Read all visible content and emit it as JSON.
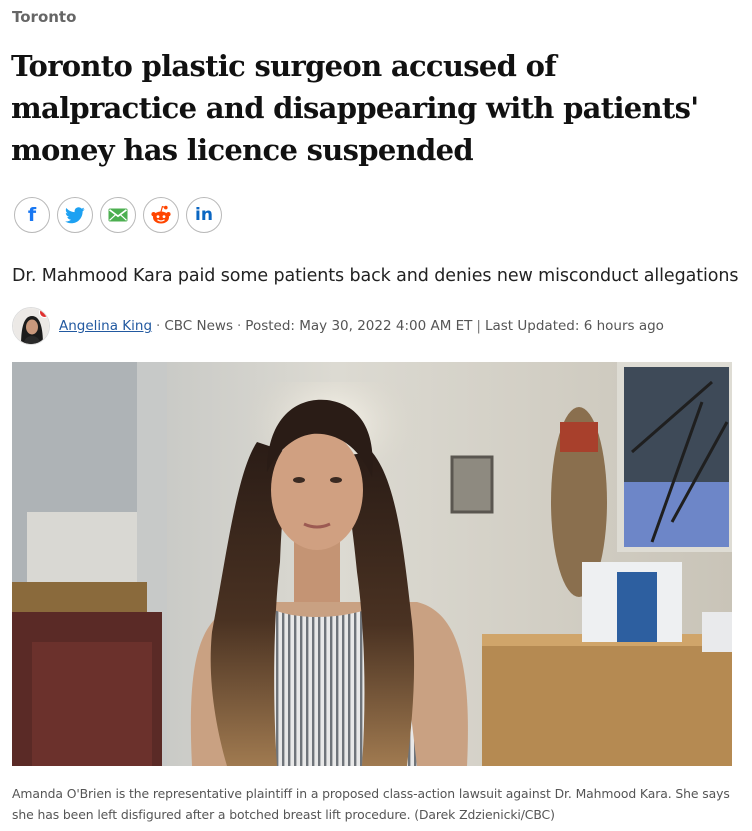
{
  "section": "Toronto",
  "headline": "Toronto plastic surgeon accused of malpractice and disappearing with patients' money has licence suspended",
  "share": {
    "facebook": "f",
    "linkedin": "in"
  },
  "deck": "Dr. Mahmood Kara paid some patients back and denies new misconduct allegations",
  "byline": {
    "author": "Angelina King",
    "source": "CBC News",
    "posted": "Posted: May 30, 2022 4:00 AM ET",
    "divider": "|",
    "updated": "Last Updated: 6 hours ago",
    "dot": "·"
  },
  "caption": "Amanda O'Brien is the representative plaintiff in a proposed class-action lawsuit against Dr. Mahmood Kara. She says she has been left disfigured after a botched breast lift procedure. (Darek Zdzienicki/CBC)",
  "colors": {
    "facebook": "#1877f2",
    "twitter": "#1da1f2",
    "email": "#4caf50",
    "reddit": "#ff4500",
    "linkedin": "#0a66c2",
    "author_link": "#2259a0"
  },
  "icons": [
    "facebook-icon",
    "twitter-icon",
    "email-icon",
    "reddit-icon",
    "linkedin-icon"
  ]
}
